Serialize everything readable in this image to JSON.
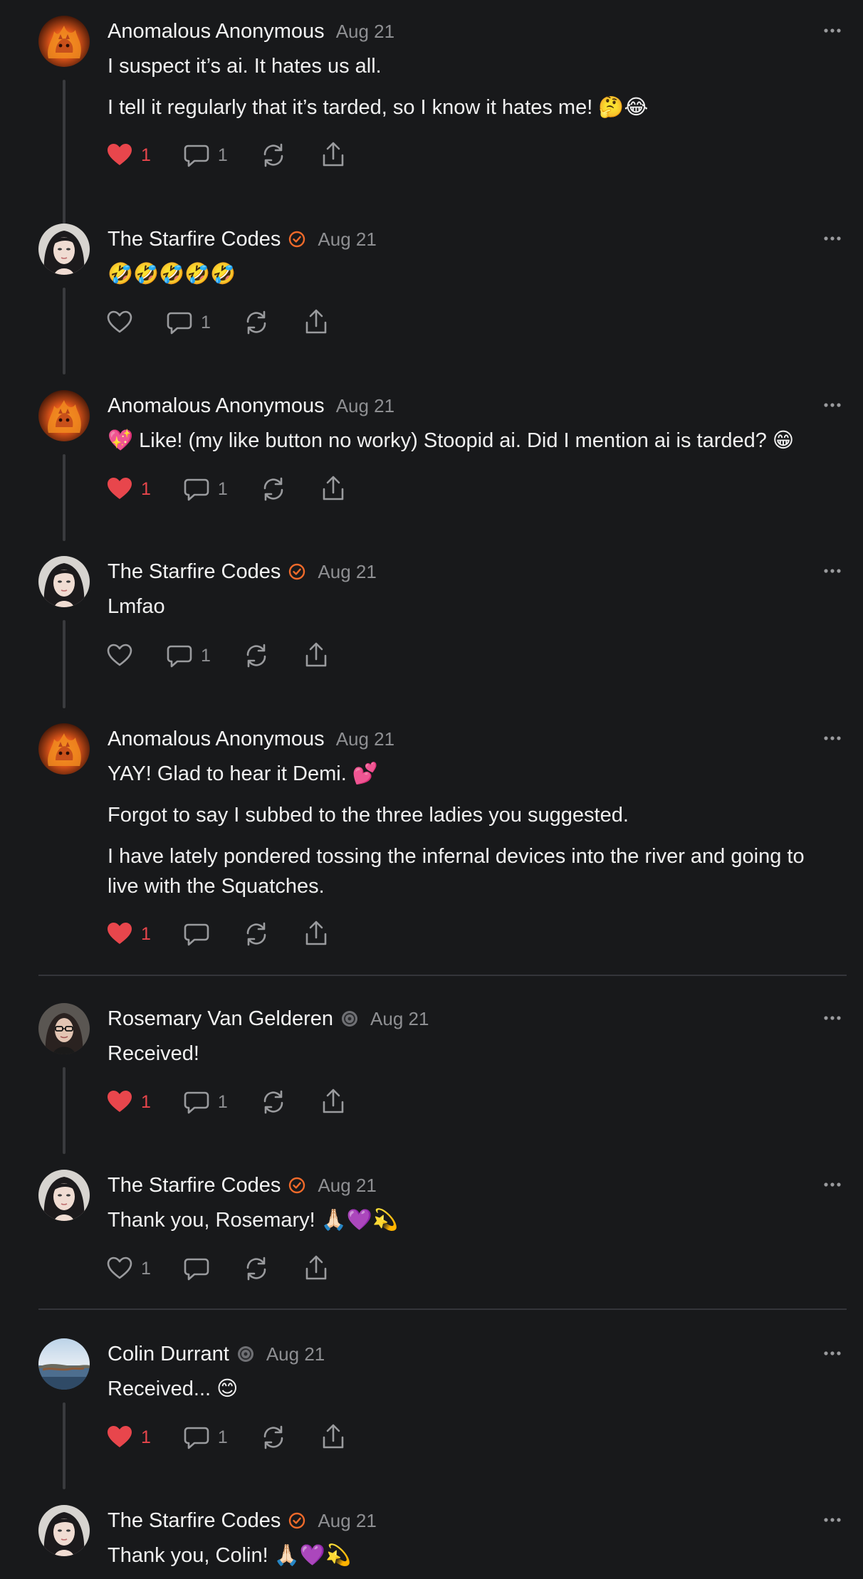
{
  "colors": {
    "background": "#18191b",
    "like_active": "#e8464c",
    "verified_badge": "#f06a2a",
    "muted": "#8e8f92"
  },
  "comments": [
    {
      "author": "Anomalous Anonymous",
      "avatar": "fire-cat-avatar",
      "badge": null,
      "date": "Aug 21",
      "paragraphs": [
        "I suspect it’s ai. It hates us all.",
        "I tell it regularly that it’s tarded, so I know it hates me! 🤔😂"
      ],
      "liked": true,
      "likes": "1",
      "replies": "1"
    },
    {
      "author": "The Starfire Codes",
      "avatar": "woman-portrait-avatar",
      "badge": "verified-check-icon",
      "date": "Aug 21",
      "paragraphs": [
        "🤣🤣🤣🤣🤣"
      ],
      "liked": false,
      "likes": "",
      "replies": "1"
    },
    {
      "author": "Anomalous Anonymous",
      "avatar": "fire-cat-avatar",
      "badge": null,
      "date": "Aug 21",
      "paragraphs": [
        "💖 Like! (my like button no worky) Stoopid ai. Did I mention ai is tarded? 😁"
      ],
      "liked": true,
      "likes": "1",
      "replies": "1"
    },
    {
      "author": "The Starfire Codes",
      "avatar": "woman-portrait-avatar",
      "badge": "verified-check-icon",
      "date": "Aug 21",
      "paragraphs": [
        "Lmfao"
      ],
      "liked": false,
      "likes": "",
      "replies": "1"
    },
    {
      "author": "Anomalous Anonymous",
      "avatar": "fire-cat-avatar",
      "badge": null,
      "date": "Aug 21",
      "paragraphs": [
        "YAY! Glad to hear it Demi. 💕",
        "Forgot to say I subbed to the three ladies you suggested.",
        "I have lately pondered tossing the infernal devices into the river and going to live with the Squatches."
      ],
      "liked": true,
      "likes": "1",
      "replies": ""
    },
    {
      "author": "Rosemary Van Gelderen",
      "avatar": "woman-glasses-avatar",
      "badge": "subscriber-badge-icon",
      "date": "Aug 21",
      "paragraphs": [
        "Received!"
      ],
      "liked": true,
      "likes": "1",
      "replies": "1"
    },
    {
      "author": "The Starfire Codes",
      "avatar": "woman-portrait-avatar",
      "badge": "verified-check-icon",
      "date": "Aug 21",
      "paragraphs": [
        "Thank you, Rosemary! 🙏🏻💜💫"
      ],
      "liked": false,
      "likes": "1",
      "replies": ""
    },
    {
      "author": "Colin Durrant",
      "avatar": "lake-landscape-avatar",
      "badge": "subscriber-badge-icon",
      "date": "Aug 21",
      "paragraphs": [
        "Received... 😊"
      ],
      "liked": true,
      "likes": "1",
      "replies": "1"
    },
    {
      "author": "The Starfire Codes",
      "avatar": "woman-portrait-avatar",
      "badge": "verified-check-icon",
      "date": "Aug 21",
      "paragraphs": [
        "Thank you, Colin! 🙏🏻💜💫"
      ],
      "liked": false,
      "likes": "",
      "replies": ""
    }
  ]
}
